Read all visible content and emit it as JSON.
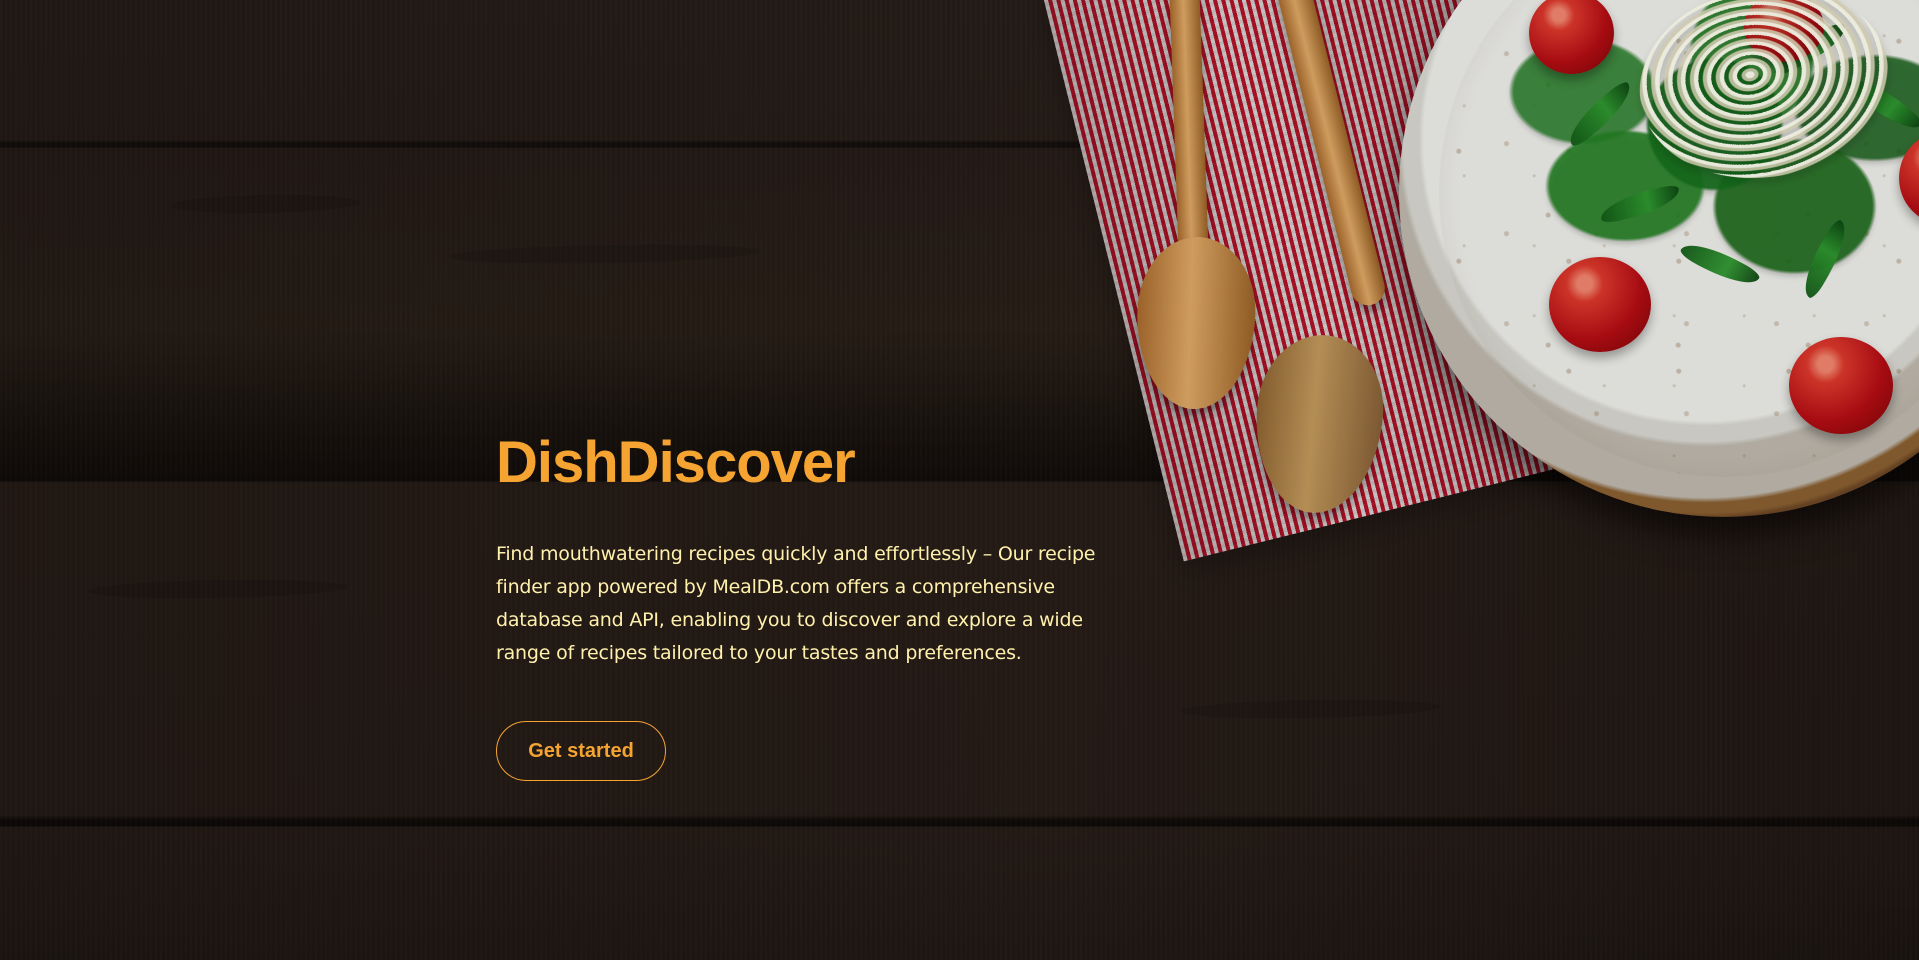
{
  "hero": {
    "title": "DishDiscover",
    "description": "Find mouthwatering recipes quickly and effortlessly – Our recipe finder app powered by MealDB.com offers a comprehensive database and API, enabling you to discover and explore a wide range of recipes tailored to your tastes and preferences.",
    "button_label": "Get started"
  },
  "colors": {
    "accent": "#f6a431",
    "description_text": "#fff0ac",
    "background_wood": "#2b211c"
  },
  "images": {
    "background": "dark-wood-table",
    "food": "arugula-salad-plate-with-wooden-spoons-and-checkered-napkin"
  }
}
